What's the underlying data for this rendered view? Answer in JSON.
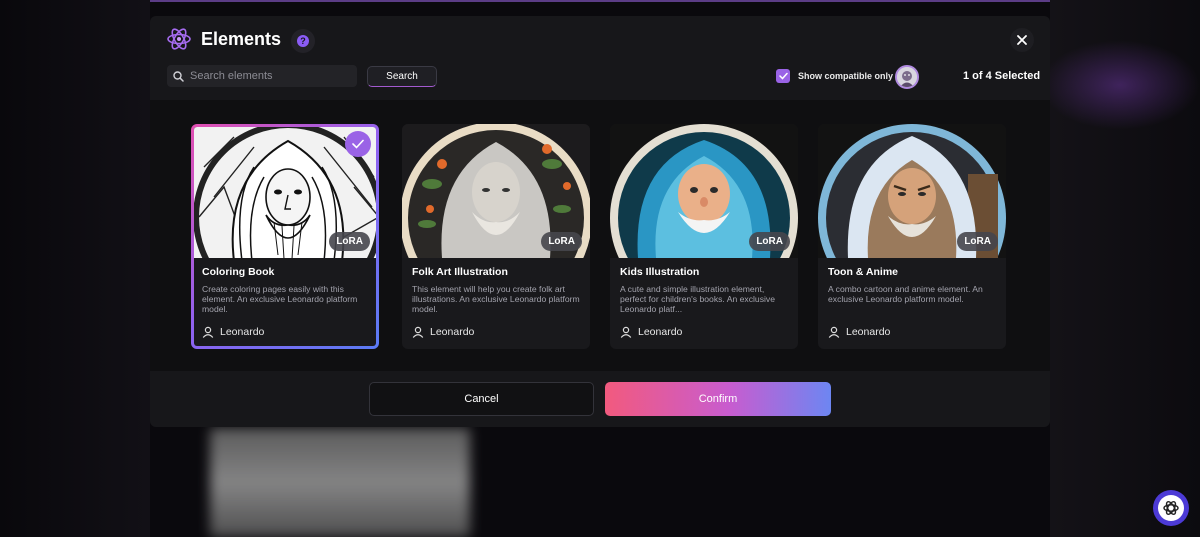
{
  "modal": {
    "title": "Elements",
    "help_icon_text": "?",
    "search": {
      "placeholder": "Search elements",
      "value": ""
    },
    "search_button": "Search",
    "compatible_label": "Show compatible only",
    "compatible_checked": true,
    "selected_count": "1 of 4 Selected"
  },
  "elements": [
    {
      "name": "Coloring Book",
      "badge": "LoRA",
      "description": "Create coloring pages easily with this element. An exclusive Leonardo platform model.",
      "author": "Leonardo",
      "selected": true
    },
    {
      "name": "Folk Art Illustration",
      "badge": "LoRA",
      "description": "This element will help you create folk art illustrations. An exclusive Leonardo platform model.",
      "author": "Leonardo",
      "selected": false
    },
    {
      "name": "Kids Illustration",
      "badge": "LoRA",
      "description": "A cute and simple illustration element, perfect for children's books. An exclusive Leonardo platf...",
      "author": "Leonardo",
      "selected": false
    },
    {
      "name": "Toon & Anime",
      "badge": "LoRA",
      "description": "A combo cartoon and anime element. An exclusive Leonardo platform model.",
      "author": "Leonardo",
      "selected": false
    }
  ],
  "footer": {
    "cancel_label": "Cancel",
    "confirm_label": "Confirm"
  },
  "colors": {
    "accent": "#9a63e6",
    "confirm_start": "#f25a7e",
    "confirm_end": "#6d86f2",
    "modal_bg": "#17171a"
  }
}
